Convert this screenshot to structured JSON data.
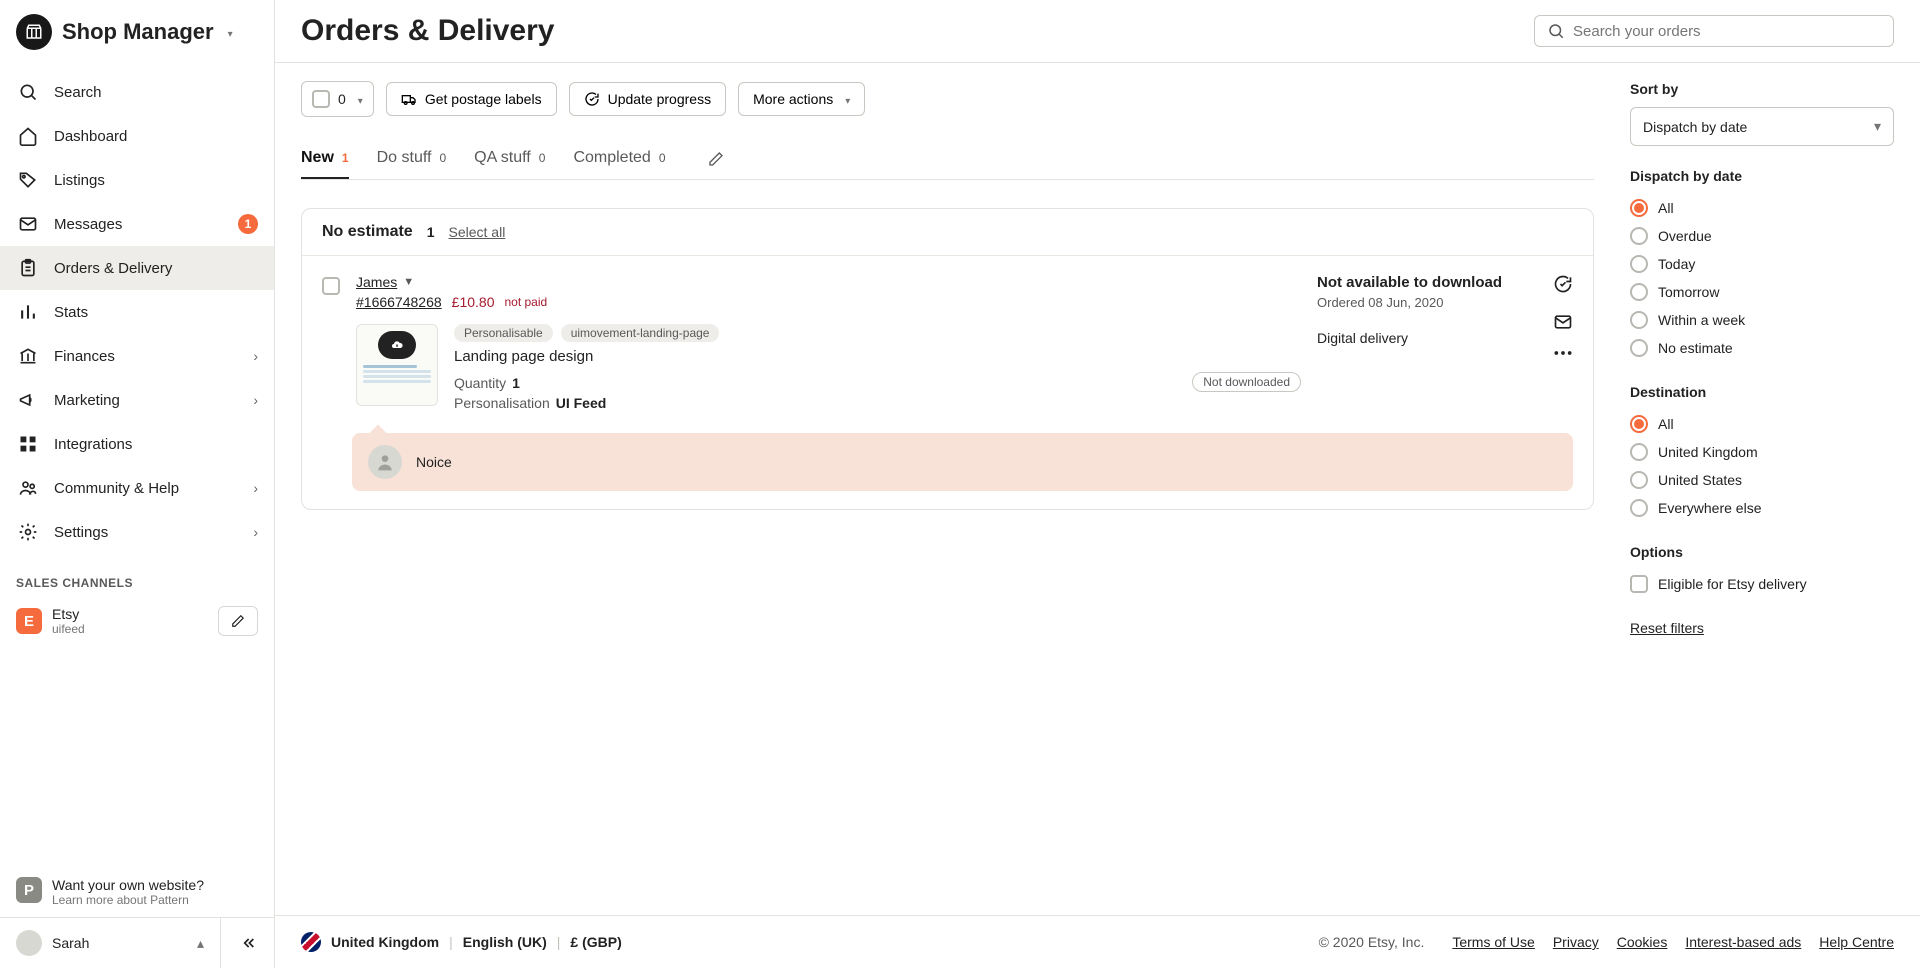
{
  "header": {
    "shop_manager": "Shop Manager"
  },
  "nav": {
    "search": "Search",
    "dashboard": "Dashboard",
    "listings": "Listings",
    "messages": "Messages",
    "messages_badge": "1",
    "orders": "Orders & Delivery",
    "stats": "Stats",
    "finances": "Finances",
    "marketing": "Marketing",
    "integrations": "Integrations",
    "community": "Community & Help",
    "settings": "Settings"
  },
  "sales_channels_label": "SALES CHANNELS",
  "channel": {
    "initial": "E",
    "name": "Etsy",
    "sub": "uifeed",
    "bg": "#f56b3d"
  },
  "pattern": {
    "initial": "P",
    "title": "Want your own website?",
    "sub": "Learn more about Pattern",
    "bg": "#8a8a84"
  },
  "user": {
    "name": "Sarah"
  },
  "page": {
    "title": "Orders & Delivery",
    "search_placeholder": "Search your orders"
  },
  "actions": {
    "selected_count": "0",
    "postage": "Get postage labels",
    "update": "Update progress",
    "more": "More actions"
  },
  "tabs": [
    {
      "label": "New",
      "count": "1",
      "active": true
    },
    {
      "label": "Do stuff",
      "count": "0",
      "active": false
    },
    {
      "label": "QA stuff",
      "count": "0",
      "active": false
    },
    {
      "label": "Completed",
      "count": "0",
      "active": false
    }
  ],
  "group": {
    "title": "No estimate",
    "count": "1",
    "select_all": "Select all"
  },
  "order": {
    "buyer": "James",
    "id": "#1666748268",
    "price": "£10.80",
    "not_paid": "not paid",
    "tags": [
      "Personalisable",
      "uimovement-landing-page"
    ],
    "item_name": "Landing page design",
    "qty_label": "Quantity",
    "qty_value": "1",
    "pers_label": "Personalisation",
    "pers_value": "UI Feed",
    "download_status": "Not available to download",
    "ordered": "Ordered 08 Jun, 2020",
    "delivery_type": "Digital delivery",
    "dl_badge": "Not downloaded",
    "note": "Noice"
  },
  "filters": {
    "sort_label": "Sort by",
    "sort_value": "Dispatch by date",
    "dispatch_label": "Dispatch by date",
    "dispatch": [
      {
        "label": "All",
        "checked": true
      },
      {
        "label": "Overdue",
        "checked": false
      },
      {
        "label": "Today",
        "checked": false
      },
      {
        "label": "Tomorrow",
        "checked": false
      },
      {
        "label": "Within a week",
        "checked": false
      },
      {
        "label": "No estimate",
        "checked": false
      }
    ],
    "dest_label": "Destination",
    "destination": [
      {
        "label": "All",
        "checked": true
      },
      {
        "label": "United Kingdom",
        "checked": false
      },
      {
        "label": "United States",
        "checked": false
      },
      {
        "label": "Everywhere else",
        "checked": false
      }
    ],
    "options_label": "Options",
    "options_check": "Eligible for Etsy delivery",
    "reset": "Reset filters"
  },
  "footer": {
    "region": "United Kingdom",
    "lang": "English (UK)",
    "currency": "£ (GBP)",
    "copyright": "© 2020 Etsy, Inc.",
    "links": [
      "Terms of Use",
      "Privacy",
      "Cookies",
      "Interest-based ads",
      "Help Centre"
    ]
  }
}
